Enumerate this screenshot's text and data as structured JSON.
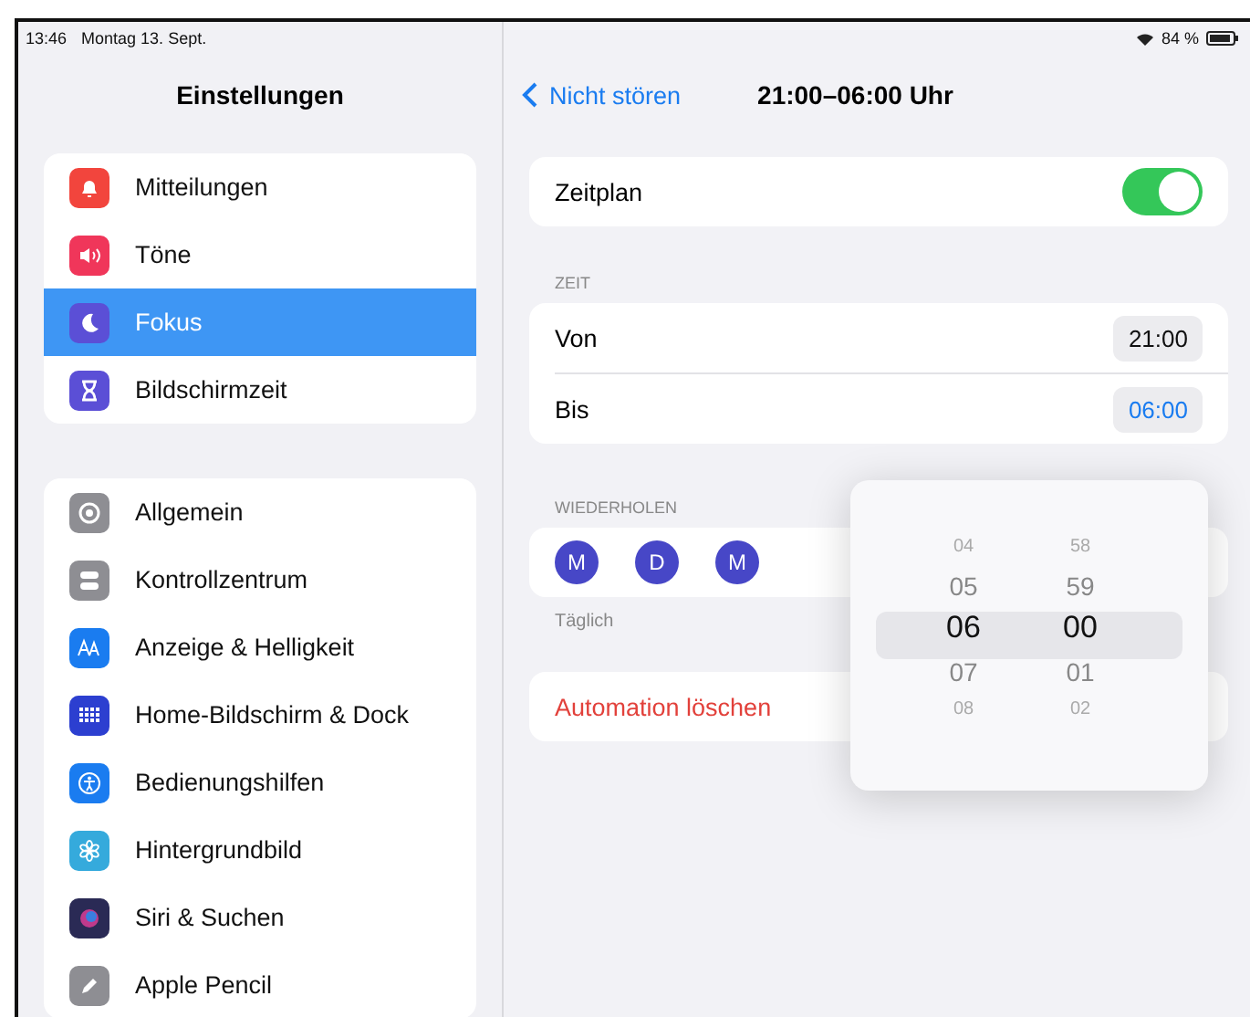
{
  "status_bar": {
    "time": "13:46",
    "date": "Montag 13. Sept.",
    "battery": "84 %"
  },
  "sidebar": {
    "title": "Einstellungen",
    "groups": [
      [
        {
          "label": "Mitteilungen",
          "color": "#f2453d",
          "selected": false
        },
        {
          "label": "Töne",
          "color": "#f0365a",
          "selected": false
        },
        {
          "label": "Fokus",
          "color": "#5b4fd6",
          "selected": true
        },
        {
          "label": "Bildschirmzeit",
          "color": "#5b4fd6",
          "selected": false
        }
      ],
      [
        {
          "label": "Allgemein",
          "color": "#8e8e93",
          "selected": false
        },
        {
          "label": "Kontrollzentrum",
          "color": "#8e8e93",
          "selected": false
        },
        {
          "label": "Anzeige & Helligkeit",
          "color": "#1a7cf0",
          "selected": false
        },
        {
          "label": "Home-Bildschirm & Dock",
          "color": "#2c3fd0",
          "selected": false
        },
        {
          "label": "Bedienungshilfen",
          "color": "#1a7cf0",
          "selected": false
        },
        {
          "label": "Hintergrundbild",
          "color": "#35aadc",
          "selected": false
        },
        {
          "label": "Siri & Suchen",
          "color": "#2a2a55",
          "selected": false
        },
        {
          "label": "Apple Pencil",
          "color": "#8e8e93",
          "selected": false
        }
      ]
    ]
  },
  "nav": {
    "back": "Nicht stören",
    "title": "21:00–06:00 Uhr"
  },
  "schedule": {
    "label": "Zeitplan",
    "on": true
  },
  "time_section": {
    "header": "ZEIT",
    "rows": [
      {
        "label": "Von",
        "value": "21:00",
        "selected": false
      },
      {
        "label": "Bis",
        "value": "06:00",
        "selected": true
      }
    ]
  },
  "repeat_section": {
    "header": "WIEDERHOLEN",
    "days": [
      {
        "label": "M",
        "selected": true
      },
      {
        "label": "D",
        "selected": true
      },
      {
        "label": "M",
        "selected": true
      }
    ],
    "footer": "Täglich"
  },
  "delete_label": "Automation löschen",
  "picker": {
    "rows": [
      {
        "hour": "04",
        "minute": "58",
        "selected": false
      },
      {
        "hour": "05",
        "minute": "59",
        "selected": false
      },
      {
        "hour": "06",
        "minute": "00",
        "selected": true
      },
      {
        "hour": "07",
        "minute": "01",
        "selected": false
      },
      {
        "hour": "08",
        "minute": "02",
        "selected": false
      }
    ]
  }
}
